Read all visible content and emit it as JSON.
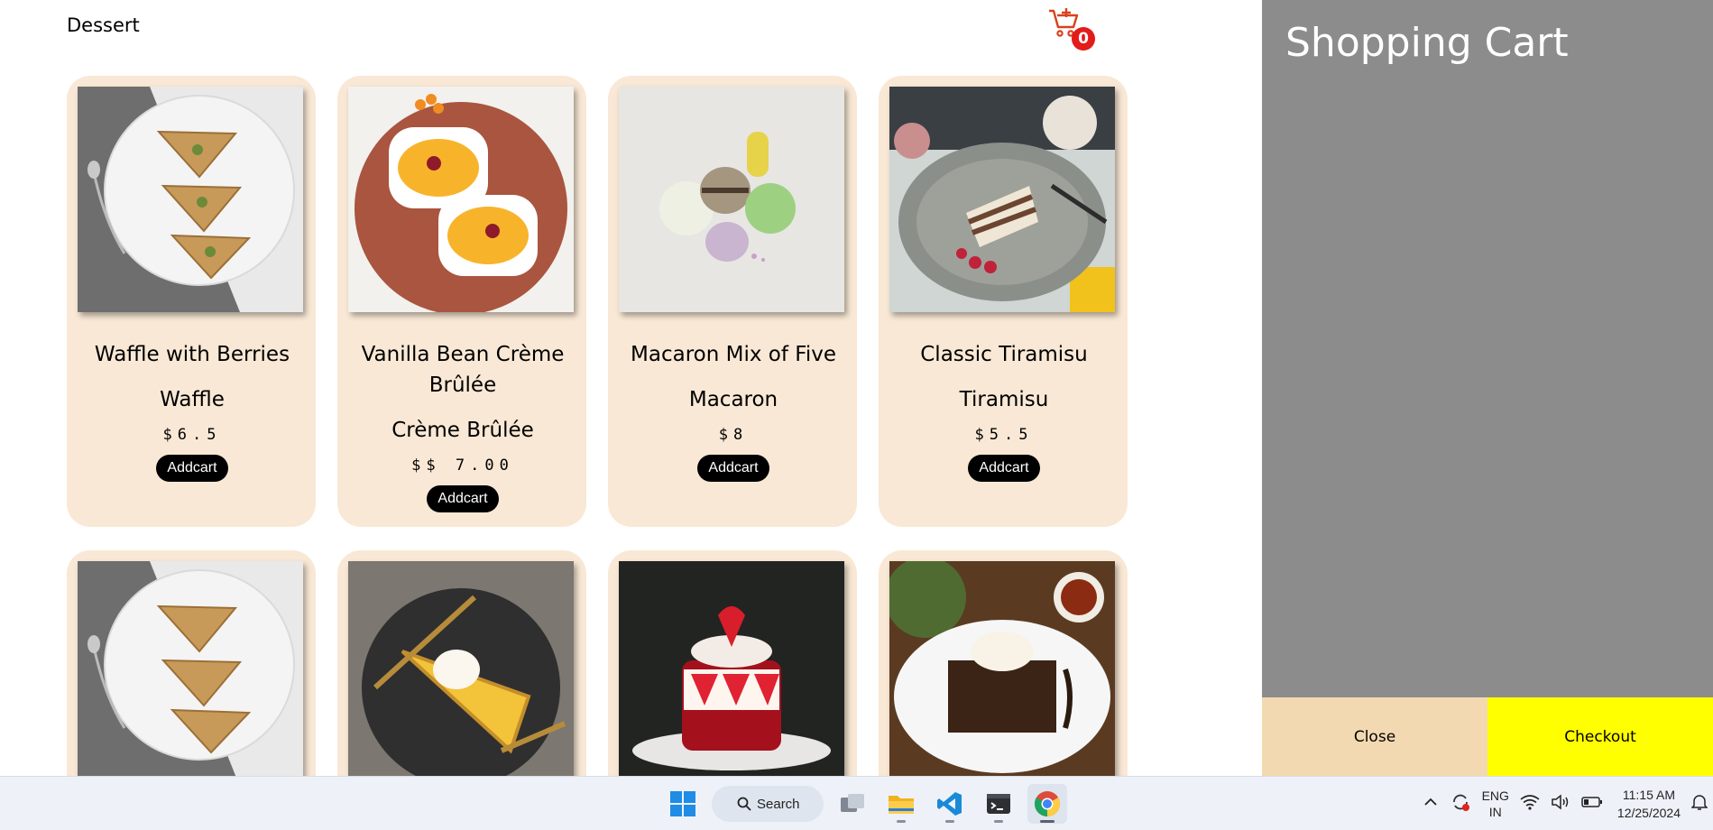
{
  "header": {
    "title": "Dessert",
    "cart_icon": "cart-plus-icon",
    "cart_count": "0"
  },
  "products": [
    {
      "name": "Waffle with Berries",
      "category": "Waffle",
      "price": "$6.5",
      "button": "Addcart",
      "image": "baklava-plate"
    },
    {
      "name": "Vanilla Bean Crème Brûlée",
      "category": "Crème Brûlée",
      "price": "$$ 7.00",
      "button": "Addcart",
      "image": "creme-brulee"
    },
    {
      "name": "Macaron Mix of Five",
      "category": "Macaron",
      "price": "$8",
      "button": "Addcart",
      "image": "macarons"
    },
    {
      "name": "Classic Tiramisu",
      "category": "Tiramisu",
      "price": "$5.5",
      "button": "Addcart",
      "image": "tiramisu"
    },
    {
      "image": "baklava-plate"
    },
    {
      "image": "lemon-tart"
    },
    {
      "image": "strawberry-cake"
    },
    {
      "image": "brownie-ice-cream"
    }
  ],
  "cart": {
    "title": "Shopping Cart",
    "close_label": "Close",
    "checkout_label": "Checkout"
  },
  "taskbar": {
    "search_label": "Search",
    "lang_line1": "ENG",
    "lang_line2": "IN",
    "time": "11:15 AM",
    "date": "12/25/2024"
  },
  "colors": {
    "card_bg": "#f9e8d5",
    "cart_panel": "#8c8c8c",
    "close_btn": "#f3d9b1",
    "checkout_btn": "#ffff00",
    "badge": "#e31b1b"
  }
}
